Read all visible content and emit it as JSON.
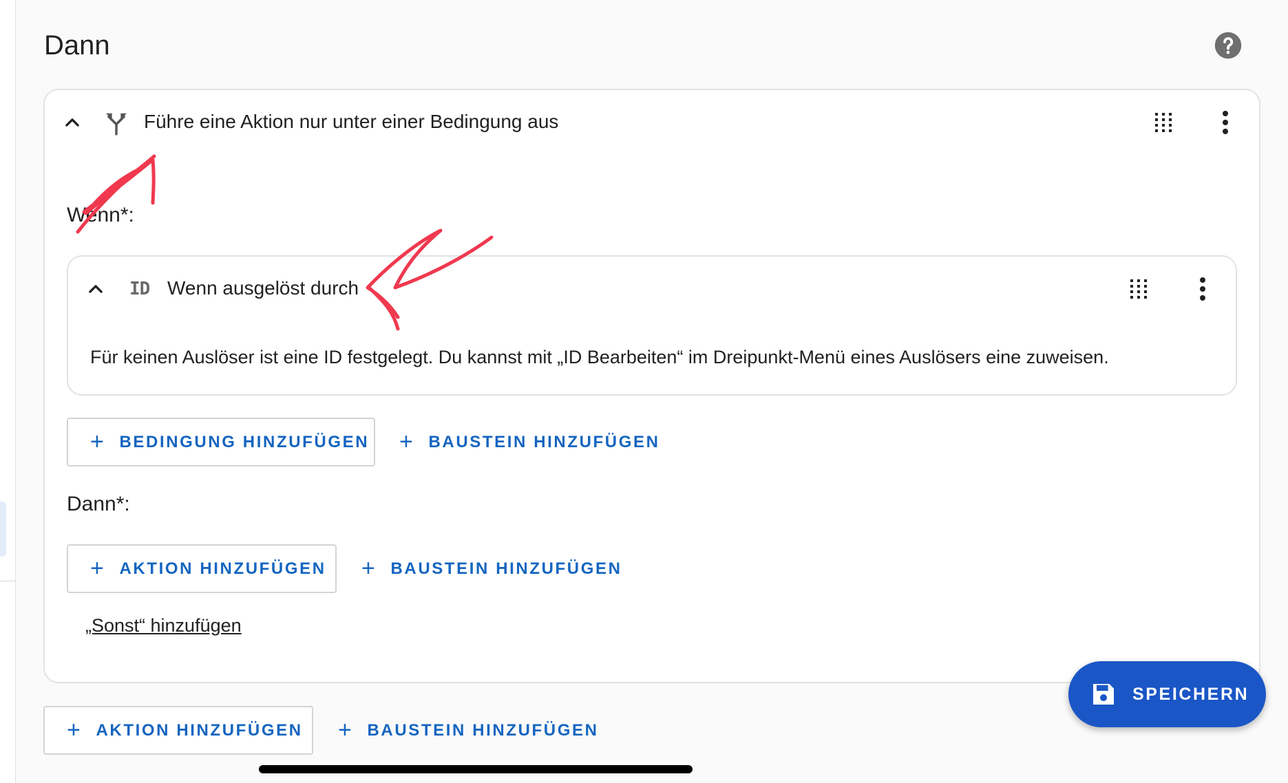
{
  "section": {
    "title": "Dann"
  },
  "outer_card": {
    "title": "Führe eine Aktion nur unter einer Bedingung aus",
    "if_label": "Wenn*:",
    "then_label": "Dann*:",
    "add_condition_label": "Bedingung hinzufügen",
    "add_block_label": "Baustein hinzufügen",
    "add_action_label": "Aktion hinzufügen",
    "add_block_label_2": "Baustein hinzufügen",
    "add_else_link": "„Sonst“ hinzufügen"
  },
  "inner_card": {
    "id_icon_text": "ID",
    "title": "Wenn ausgelöst durch",
    "message": "Für keinen Auslöser ist eine ID festgelegt. Du kannst mit „ID Bearbeiten“ im Dreipunkt-Menü eines Auslösers eine zuweisen."
  },
  "bottom": {
    "add_action_label": "Aktion hinzufügen",
    "add_block_label": "Baustein hinzufügen"
  },
  "fab": {
    "label": "SPEICHERN"
  },
  "colors": {
    "accent": "#1565c0",
    "fab_background": "#1a56c6",
    "annotation": "#f0394f",
    "card_border": "#e2e2e2"
  },
  "icons": {
    "help": "help-circle-icon",
    "collapse": "chevron-up-icon",
    "choose": "call-split-icon",
    "drag": "drag-handle-icon",
    "menu": "dots-vertical-icon",
    "id": "id-icon",
    "save": "floppy-disk-icon"
  }
}
